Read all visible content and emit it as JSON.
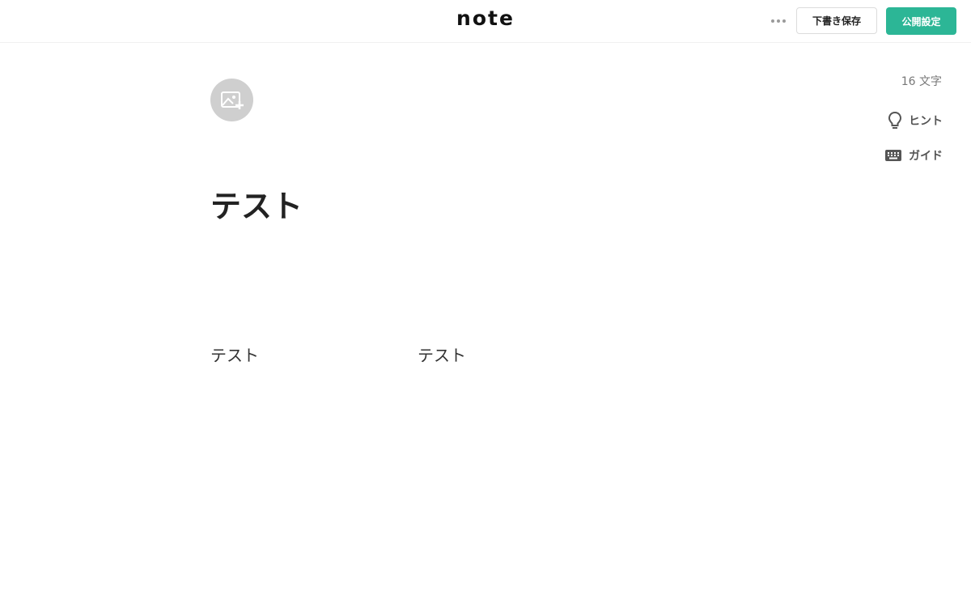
{
  "header": {
    "logo": "note",
    "more_icon": "more-horizontal-icon",
    "draft_label": "下書き保存",
    "publish_label": "公開設定",
    "accent_color": "#2cb696"
  },
  "editor": {
    "image_icon": "add-image-icon",
    "title": "テスト",
    "body": [
      "テスト",
      "テスト"
    ]
  },
  "sidebar": {
    "char_count": "16 文字",
    "hint_label": "ヒント",
    "hint_icon": "lightbulb-icon",
    "guide_label": "ガイド",
    "guide_icon": "keyboard-icon"
  }
}
